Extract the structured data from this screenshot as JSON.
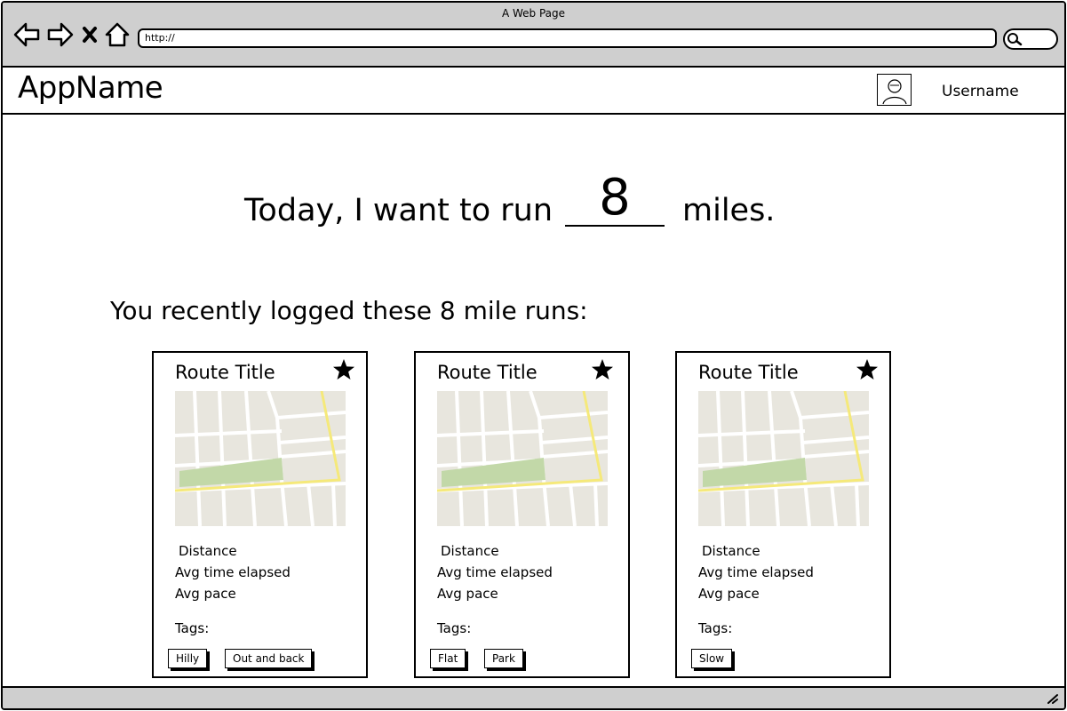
{
  "window": {
    "title": "A Web Page",
    "url": "http://"
  },
  "header": {
    "app_name": "AppName",
    "username": "Username"
  },
  "goal": {
    "prefix": "Today, I want to run",
    "miles_value": "8",
    "suffix": "miles."
  },
  "recent_heading": "You recently logged these 8 mile runs:",
  "cards": [
    {
      "title": "Route Title",
      "distance": "Distance",
      "avg_time": "Avg time elapsed",
      "avg_pace": "Avg pace",
      "tags_label": "Tags:",
      "tags": [
        "Hilly",
        "Out and back"
      ]
    },
    {
      "title": "Route Title",
      "distance": "Distance",
      "avg_time": "Avg time elapsed",
      "avg_pace": "Avg pace",
      "tags_label": "Tags:",
      "tags": [
        "Flat",
        "Park"
      ]
    },
    {
      "title": "Route Title",
      "distance": "Distance",
      "avg_time": "Avg time elapsed",
      "avg_pace": "Avg pace",
      "tags_label": "Tags:",
      "tags": [
        "Slow"
      ]
    }
  ],
  "icons": [
    "back-icon",
    "forward-icon",
    "close-icon",
    "home-icon",
    "search-icon",
    "user-icon",
    "star-icon",
    "resize-icon"
  ],
  "colors": {
    "chrome": "#cfcfcf",
    "map_bg": "#e8e6de",
    "map_road": "#ffffff",
    "map_highlight": "#f5e97a",
    "map_park": "#c2d8a8"
  }
}
